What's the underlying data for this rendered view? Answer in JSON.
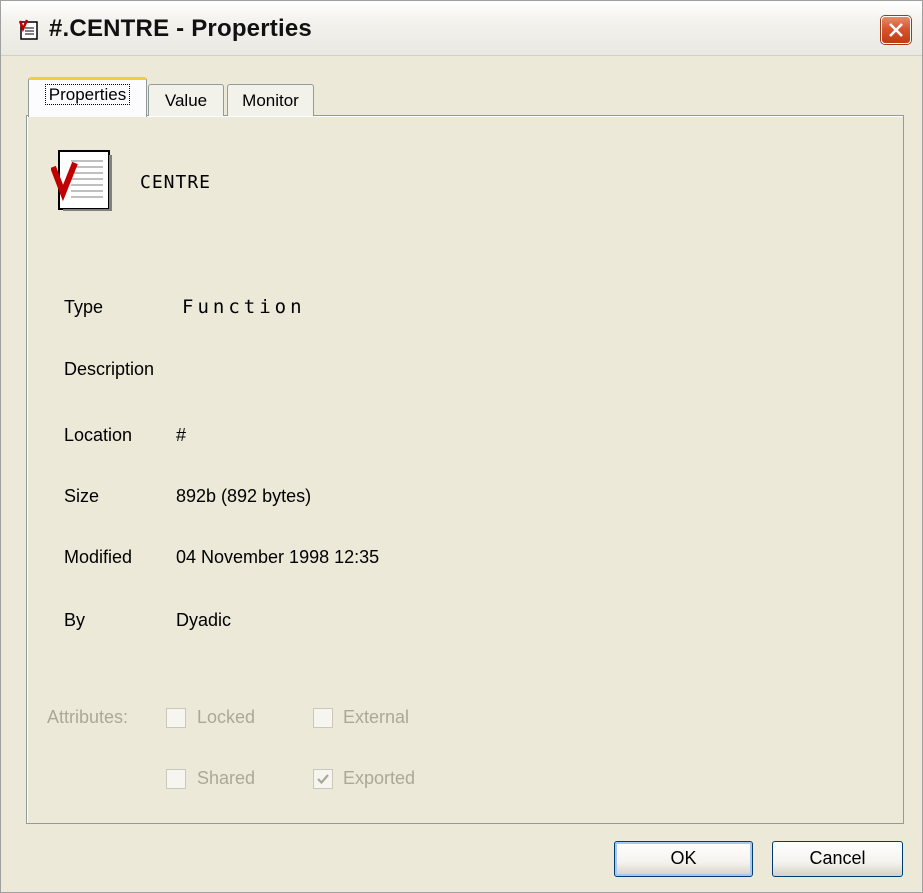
{
  "window": {
    "title": "#.CENTRE - Properties",
    "title_icon": "properties-window-icon",
    "close_icon": "close-icon"
  },
  "tabs": [
    {
      "label": "Properties",
      "active": true
    },
    {
      "label": "Value",
      "active": false
    },
    {
      "label": "Monitor",
      "active": false
    }
  ],
  "object": {
    "icon": "function-document-icon",
    "name": "CENTRE"
  },
  "properties": {
    "type_label": "Type",
    "type_value": "Function",
    "description_label": "Description",
    "description_value": "",
    "location_label": "Location",
    "location_value": "#",
    "size_label": "Size",
    "size_value": "892b (892 bytes)",
    "modified_label": "Modified",
    "modified_value": "04 November 1998 12:35",
    "by_label": "By",
    "by_value": "Dyadic"
  },
  "attributes": {
    "label": "Attributes:",
    "locked": {
      "label": "Locked",
      "checked": false,
      "enabled": false
    },
    "external": {
      "label": "External",
      "checked": false,
      "enabled": false
    },
    "shared": {
      "label": "Shared",
      "checked": false,
      "enabled": false
    },
    "exported": {
      "label": "Exported",
      "checked": true,
      "enabled": false
    }
  },
  "buttons": {
    "ok_label": "OK",
    "cancel_label": "Cancel"
  },
  "colors": {
    "window_bg": "#ece9d8",
    "disabled_text": "#aca899",
    "close_button": "#d7552e",
    "active_tab_highlight": "#ffc83c",
    "check_mark": "#aca899"
  }
}
